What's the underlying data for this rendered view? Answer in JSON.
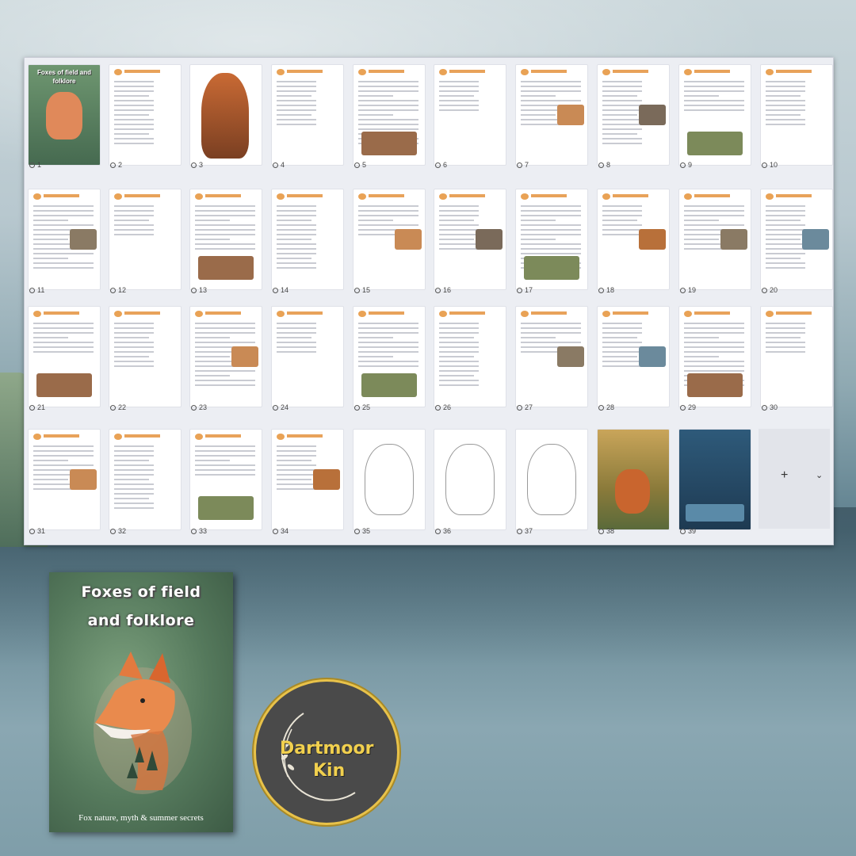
{
  "pages": [
    "1",
    "2",
    "3",
    "4",
    "5",
    "6",
    "7",
    "8",
    "9",
    "10",
    "11",
    "12",
    "13",
    "14",
    "15",
    "16",
    "17",
    "18",
    "19",
    "20",
    "21",
    "22",
    "23",
    "24",
    "25",
    "26",
    "27",
    "28",
    "29",
    "30",
    "31",
    "32",
    "33",
    "34",
    "35",
    "36",
    "37",
    "38",
    "39"
  ],
  "thumb_cover": {
    "title": "Foxes of field and folklore"
  },
  "add_tile": {
    "plus": "+",
    "chevron": "⌄"
  },
  "cover": {
    "title_line1": "Foxes of field",
    "title_line2": "and folklore",
    "subtitle": "Fox nature, myth & summer secrets"
  },
  "logo": {
    "line1": "Dartmoor",
    "line2": "Kin"
  },
  "colors": {
    "accent": "#e8a25a",
    "brand_gold": "#f1d04e",
    "cover_green": "#55795c"
  }
}
